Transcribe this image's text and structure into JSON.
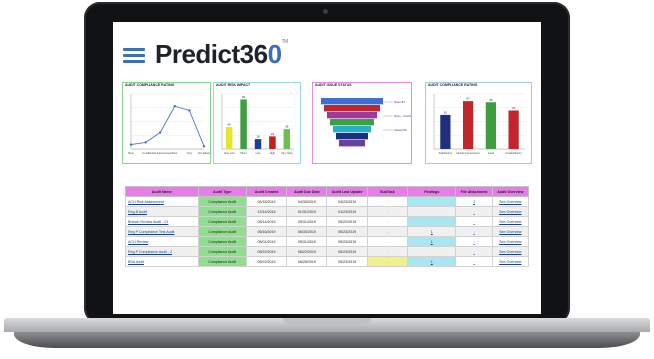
{
  "brand": {
    "name_prefix": "Predict36",
    "name_suffix": "0",
    "trademark": "TM"
  },
  "colors": {
    "brand_blue": "#3b6fb6",
    "header_pink": "#e87ce8",
    "type_green": "#8ee08e",
    "findings_cyan": "#a9e6f2"
  },
  "menu_icon": "hamburger-icon",
  "charts": {
    "compliance_rating": {
      "title": "AUDIT COMPLIANCE RATING"
    },
    "risk_impact": {
      "title": "AUDIT RISK IMPACT"
    },
    "issue_status": {
      "title": "AUDIT ISSUE STATUS"
    },
    "compliance_rating_2": {
      "title": "AUDIT COMPLIANCE RATING"
    }
  },
  "chart_data": [
    {
      "type": "line",
      "title": "AUDIT COMPLIANCE RATING",
      "categories": [
        "Best",
        "Good",
        "Needs Improvement",
        "Poor",
        "Very",
        "Not Rated"
      ],
      "values": [
        8,
        12,
        30,
        78,
        70,
        5
      ],
      "ylim": [
        0,
        100
      ],
      "color": "#4a74c4"
    },
    {
      "type": "bar",
      "title": "AUDIT RISK IMPACT",
      "categories": [
        "Very Low",
        "Minor",
        "Low",
        "High",
        "Very High"
      ],
      "values": [
        40,
        90,
        18,
        23,
        36
      ],
      "colors": [
        "#e6e630",
        "#3f9e3f",
        "#1f3d9e",
        "#c02020",
        "#6fbf4f"
      ],
      "ylim": [
        0,
        100
      ]
    },
    {
      "type": "bar",
      "title": "AUDIT ISSUE STATUS",
      "categories": [
        "Open",
        "Open - Overdue",
        "Closed"
      ],
      "values": [
        84,
        68,
        50
      ],
      "colors": [
        "#3d6fd0",
        "#c0262c",
        "#9e3a9e"
      ],
      "ylim": [
        0,
        100
      ]
    },
    {
      "type": "bar",
      "title": "AUDIT COMPLIANCE RATING",
      "categories": [
        "Satisfactory",
        "Needs Improvement",
        "Good",
        "Unsatisfactory"
      ],
      "values": [
        62,
        87,
        85,
        70
      ],
      "colors": [
        "#1f2f7f",
        "#c0262c",
        "#3f9e3f",
        "#c0262c"
      ],
      "ylim": [
        0,
        100
      ]
    }
  ],
  "table": {
    "headers": [
      "Audit Name",
      "Audit Type",
      "Audit Created",
      "Audit Due Date",
      "Audit Last Update",
      "SubTask",
      "Findings",
      "File Attachment",
      "Audit Overview"
    ],
    "rows": [
      [
        "ACH Risk Assessment",
        "Compliance Audit",
        "04/15/2019",
        "04/30/2019",
        "04/23/2019",
        ".",
        "",
        "1",
        "See Overview"
      ],
      [
        "Reg B Audit",
        "Compliance Audit",
        "12/14/2018",
        "01/31/2019",
        "01/23/2019",
        ".",
        "",
        ".",
        "See Overview"
      ],
      [
        "Branch Review Audit - 01",
        "Compliance Audit",
        "05/14/2019",
        "05/31/2019",
        "05/22/2019",
        ".",
        "",
        ".",
        "See Overview"
      ],
      [
        "Reg P Compliance Test Audit",
        "Compliance Audit",
        "05/16/2019",
        "06/30/2019",
        "05/23/2019",
        ".",
        "1",
        ".",
        "See Overview"
      ],
      [
        "ACH Review",
        "Compliance Audit",
        "05/01/2019",
        "05/31/2019",
        "05/23/2019",
        ".",
        "1",
        ".",
        "See Overview"
      ],
      [
        "Reg P Compliance Audit - 2",
        "Compliance Audit",
        "05/22/2019",
        "06/22/2019",
        "05/23/2019",
        ".",
        "",
        ".",
        "See Overview"
      ],
      [
        "BSA Audit",
        "Compliance Audit",
        "05/22/2019",
        "06/28/2019",
        "05/23/2019",
        ".",
        "1",
        ".",
        "See Overview"
      ]
    ]
  }
}
